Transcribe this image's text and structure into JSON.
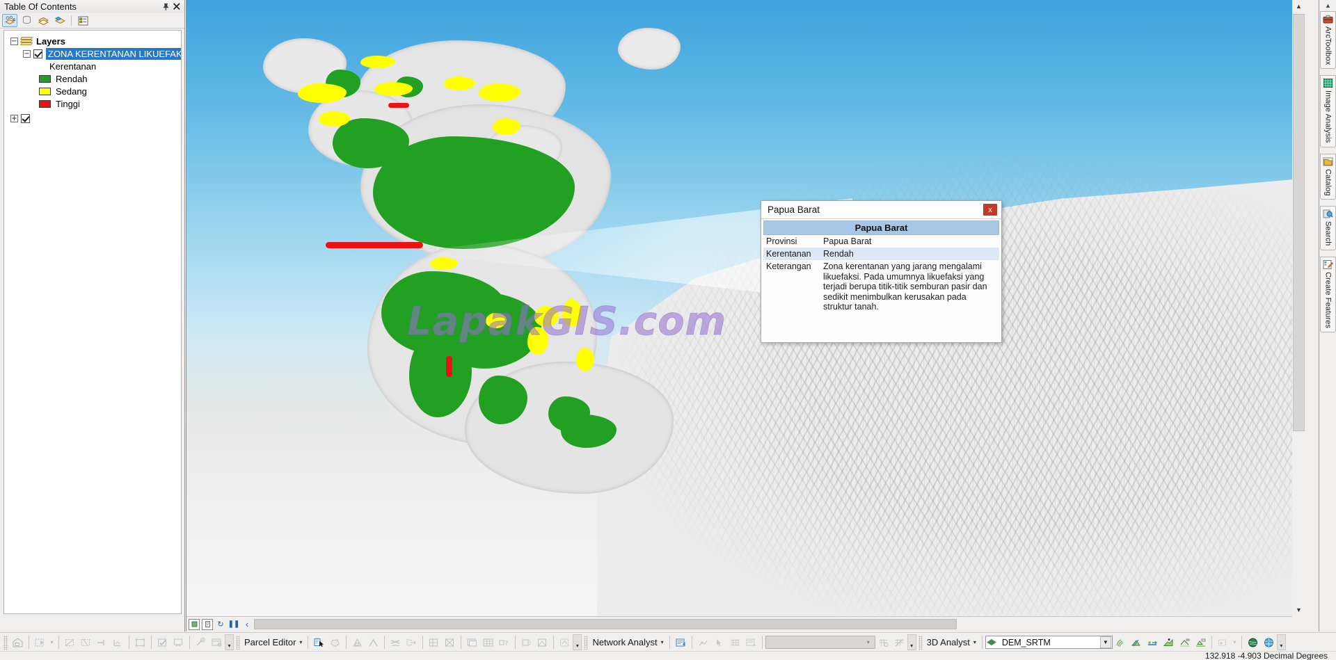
{
  "toc": {
    "title": "Table Of Contents",
    "pin_icon": "pin-icon",
    "close_icon": "close-icon",
    "toolbar": [
      {
        "name": "list-by-drawing-order-icon",
        "selected": true
      },
      {
        "name": "list-by-source-icon",
        "selected": false
      },
      {
        "name": "list-by-visibility-icon",
        "selected": false
      },
      {
        "name": "list-by-selection-icon",
        "selected": false
      },
      {
        "name": "options-icon",
        "selected": false
      }
    ],
    "tree": {
      "root_label": "Layers",
      "layer_label": "ZONA KERENTANAN LIKUEFAKSI",
      "field_label": "Kerentanan",
      "classes": [
        {
          "label": "Rendah",
          "color": "#22a022"
        },
        {
          "label": "Sedang",
          "color": "#ffff00"
        },
        {
          "label": "Tinggi",
          "color": "#ee1111"
        }
      ]
    }
  },
  "map": {
    "watermark": "LapakGIS.com",
    "nav_buttons": [
      {
        "name": "data-view-button",
        "glyph": "▣"
      },
      {
        "name": "layout-view-button",
        "glyph": "☷"
      },
      {
        "name": "refresh-view-button",
        "glyph": "↻"
      },
      {
        "name": "pause-drawing-button",
        "glyph": "❚❚"
      },
      {
        "name": "previous-extent-button",
        "glyph": "‹"
      }
    ]
  },
  "popup": {
    "window_title": "Papua Barat",
    "close_label": "x",
    "header": "Papua Barat",
    "rows": [
      {
        "key": "Provinsi",
        "value": "Papua Barat",
        "alt": false
      },
      {
        "key": "Kerentanan",
        "value": "Rendah",
        "alt": true
      },
      {
        "key": "Keterangan",
        "value": "Zona kerentanan yang jarang mengalami likuefaksi. Pada umumnya likuefaksi yang terjadi berupa titik-titik semburan pasir dan sedikit menimbulkan kerusakan pada struktur tanah.",
        "alt": false
      }
    ]
  },
  "right_dock": {
    "collapse_icon": "chevron-up-icon",
    "tabs": [
      {
        "label": "ArcToolbox",
        "icon": "toolbox-icon",
        "color": "#b5452f"
      },
      {
        "label": "Image Analysis",
        "icon": "image-analysis-icon",
        "color": "#13a06a"
      },
      {
        "label": "Catalog",
        "icon": "catalog-icon",
        "color": "#d8a81f"
      },
      {
        "label": "Search",
        "icon": "search-icon",
        "color": "#3b8fd0"
      },
      {
        "label": "Create Features",
        "icon": "create-features-icon",
        "color": "#cf6a2a"
      }
    ]
  },
  "toolbars": {
    "editor": {
      "items": [
        {
          "name": "editor-home-icon",
          "glyph": "⌂",
          "disabled": true
        },
        {
          "name": "edit-vertices-icon",
          "glyph": "⬚",
          "disabled": true
        },
        {
          "name": "edit-vertices-dropdown",
          "glyph": "▾",
          "disabled": true
        },
        {
          "name": "reshape-feature-icon",
          "glyph": "⬚",
          "disabled": true
        },
        {
          "name": "cut-polygons-icon",
          "glyph": "⬚",
          "disabled": true
        },
        {
          "name": "split-icon",
          "glyph": "⊣",
          "disabled": true
        },
        {
          "name": "construct-points-icon",
          "glyph": "⌐",
          "disabled": true
        },
        {
          "name": "topology-edit-icon",
          "glyph": "⬚",
          "disabled": true
        },
        {
          "name": "validate-features-icon",
          "glyph": "✔",
          "disabled": true
        },
        {
          "name": "attributes-icon",
          "glyph": "☑",
          "disabled": true
        },
        {
          "name": "snapping-icon",
          "glyph": "⊕",
          "disabled": true
        },
        {
          "name": "create-features-window-icon",
          "glyph": "⊟",
          "disabled": true
        }
      ],
      "overflow_glyph": "▾"
    },
    "parcel_editor": {
      "label": "Parcel Editor",
      "caret": "▾",
      "items": [
        {
          "name": "parcel-select-icon",
          "glyph": "➤",
          "disabled": false
        },
        {
          "name": "parcel-polygon-icon",
          "glyph": "⬟",
          "disabled": true
        },
        {
          "name": "parcel-construction-icon",
          "glyph": "△",
          "disabled": true
        },
        {
          "name": "parcel-lines-icon",
          "glyph": "∧",
          "disabled": true
        },
        {
          "name": "parcel-join-icon",
          "glyph": "⨉",
          "disabled": true
        },
        {
          "name": "parcel-merge-icon",
          "glyph": "⬚",
          "disabled": true
        },
        {
          "name": "parcel-division-icon",
          "glyph": "⬚",
          "disabled": true
        },
        {
          "name": "parcel-remainder-icon",
          "glyph": "⬚",
          "disabled": true
        },
        {
          "name": "parcel-details-icon",
          "glyph": "☷",
          "disabled": true
        },
        {
          "name": "parcel-table-icon",
          "glyph": "▦",
          "disabled": true
        },
        {
          "name": "parcel-query-icon",
          "glyph": "?",
          "disabled": true
        },
        {
          "name": "parcel-history-icon",
          "glyph": "◔",
          "disabled": true
        },
        {
          "name": "parcel-plan-icon",
          "glyph": "⬚",
          "disabled": true
        },
        {
          "name": "parcel-explorer-icon",
          "glyph": "⬚",
          "disabled": true
        }
      ],
      "overflow_glyph": "▾"
    },
    "network_analyst": {
      "label": "Network Analyst",
      "caret": "▾",
      "items": [
        {
          "name": "network-analyst-window-icon",
          "glyph": "☰",
          "disabled": false
        },
        {
          "name": "create-network-location-icon",
          "glyph": "✙",
          "disabled": true
        },
        {
          "name": "select-network-location-icon",
          "glyph": "➤",
          "disabled": true
        },
        {
          "name": "build-network-icon",
          "glyph": "▦",
          "disabled": true
        },
        {
          "name": "directions-window-icon",
          "glyph": "☷",
          "disabled": true
        }
      ],
      "combo_value": "",
      "combo_arrow": "▾",
      "trailing_items": [
        {
          "name": "solve-icon",
          "glyph": "▦",
          "disabled": true
        },
        {
          "name": "network-dataset-icon",
          "glyph": "⨉",
          "disabled": true
        }
      ],
      "overflow_glyph": "▾"
    },
    "analyst_3d": {
      "label": "3D Analyst",
      "caret": "▾",
      "layer_icon": "surface-layer-icon",
      "layer_value": "DEM_SRTM",
      "combo_arrow": "▼",
      "items": [
        {
          "name": "contour-tool-icon",
          "glyph": "≋",
          "disabled": false
        },
        {
          "name": "steepest-path-icon",
          "glyph": "↗",
          "disabled": false
        },
        {
          "name": "line-of-sight-icon",
          "glyph": "⟶",
          "disabled": false
        },
        {
          "name": "profile-graph-icon",
          "glyph": "↗",
          "disabled": false
        },
        {
          "name": "interpolate-line-icon",
          "glyph": "╱",
          "disabled": false
        },
        {
          "name": "interpolate-polygon-icon",
          "glyph": "⬟",
          "disabled": false
        },
        {
          "name": "create-steepest-path-icon",
          "glyph": "⬟",
          "disabled": false
        },
        {
          "name": "3d-effects-icon",
          "glyph": "✦",
          "disabled": true
        },
        {
          "name": "3d-effects-dropdown",
          "glyph": "▾",
          "disabled": true
        },
        {
          "name": "arcscene-icon",
          "glyph": "●",
          "disabled": false
        },
        {
          "name": "arcglobe-icon",
          "glyph": "●",
          "disabled": false
        }
      ],
      "overflow_glyph": "▾"
    }
  },
  "status": {
    "coordinates": "132.918  -4.903 Decimal Degrees"
  }
}
